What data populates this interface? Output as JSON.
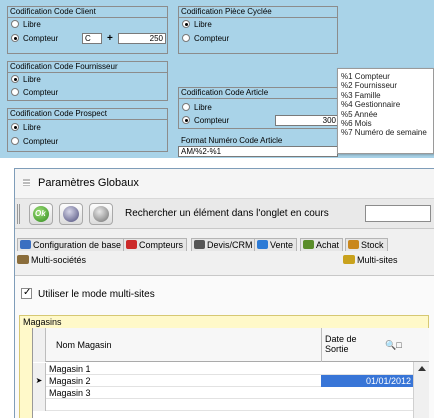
{
  "codification": {
    "client": {
      "title": "Codification Code Client",
      "opt_free": "Libre",
      "opt_counter": "Compteur",
      "prefix": "C",
      "plus": "+",
      "counter_value": "250"
    },
    "piece": {
      "title": "Codification Pièce Cyclée",
      "opt_free": "Libre",
      "opt_counter": "Compteur"
    },
    "supplier": {
      "title": "Codification Code Fournisseur",
      "opt_free": "Libre",
      "opt_counter": "Compteur"
    },
    "prospect": {
      "title": "Codification Code Prospect",
      "opt_free": "Libre",
      "opt_counter": "Compteur"
    },
    "article": {
      "title": "Codification Code Article",
      "opt_free": "Libre",
      "opt_counter": "Compteur",
      "counter_value": "300",
      "format_label": "Format Numéro Code Article",
      "format_value": "AM/%2-%1"
    },
    "popup_items": [
      "%1 Compteur",
      "%2 Fournisseur",
      "%3 Famille",
      "%4 Gestionnaire",
      "%5 Année",
      "%6 Mois",
      "%7 Numéro de semaine"
    ]
  },
  "window": {
    "title": "Paramètres Globaux",
    "search_label": "Rechercher un élément dans l'onglet en cours",
    "search_value": "",
    "tabs": [
      {
        "label": "Configuration de base",
        "color": "#3b6fc1"
      },
      {
        "label": "Compteurs",
        "color": "#cc2a2a"
      },
      {
        "label": "Devis/CRM",
        "color": "#555555"
      },
      {
        "label": "Vente",
        "color": "#2d7bd6"
      },
      {
        "label": "Achat",
        "color": "#5a8d2a"
      },
      {
        "label": "Stock",
        "color": "#c9871d"
      }
    ],
    "subtab_left": "Multi-sociétés",
    "subtab_right": "Multi-sites",
    "checkbox_label": "Utiliser le mode multi-sites",
    "stores": {
      "title": "Magasins",
      "col_name": "Nom Magasin",
      "col_date_1": "Date de",
      "col_date_2": "Sortie",
      "rows": [
        {
          "name": "Magasin 1",
          "date": ""
        },
        {
          "name": "Magasin 2",
          "date": "01/01/2012"
        },
        {
          "name": "Magasin 3",
          "date": ""
        }
      ]
    }
  },
  "colors": {
    "panel_bg": "#a9d3e8",
    "group_bg": "#fff9c9",
    "selection": "#3875d7"
  }
}
